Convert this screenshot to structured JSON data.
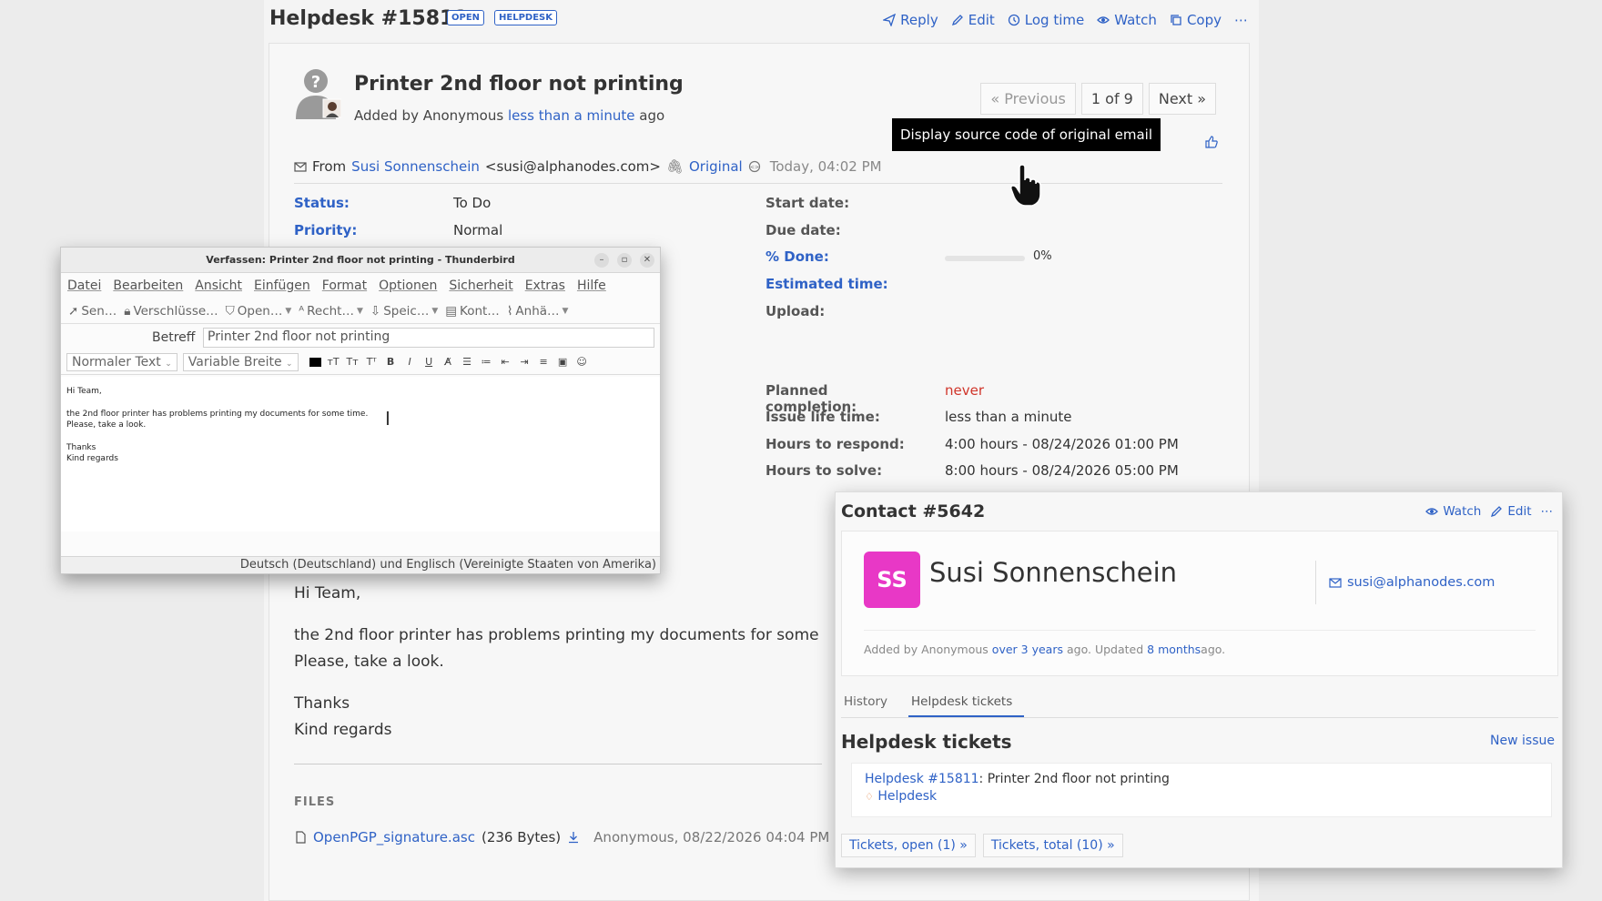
{
  "issue": {
    "title": "Helpdesk #15811",
    "badges": [
      "OPEN",
      "HELPDESK"
    ],
    "actions": [
      "Reply",
      "Edit",
      "Log time",
      "Watch",
      "Copy"
    ],
    "subject": "Printer 2nd floor not printing",
    "added_prefix": "Added by Anonymous",
    "added_time": "less than a minute",
    "added_suffix": "ago",
    "pager": {
      "previous": "« Previous",
      "position": "1 of 9",
      "next": "Next »"
    },
    "from_label": "From",
    "from_name": "Susi Sonnenschein",
    "from_email": "<susi@alphanodes.com>",
    "original_label": "Original",
    "from_date": "Today, 04:02 PM",
    "tooltip": "Display source code of original email",
    "attributes_left": [
      {
        "key": "Status:",
        "value": "To Do"
      },
      {
        "key": "Priority:",
        "value": "Normal"
      }
    ],
    "attributes_right": [
      {
        "key": "Start date:",
        "value": ""
      },
      {
        "key": "Due date:",
        "value": ""
      },
      {
        "key": "% Done:",
        "value": "0%"
      },
      {
        "key": "Estimated time:",
        "value": ""
      },
      {
        "key": "Upload:",
        "value": ""
      }
    ],
    "done_ratio": 0,
    "sla": [
      {
        "key": "Planned completion:",
        "value": "never"
      },
      {
        "key": "Issue life time:",
        "value": "less than a minute"
      },
      {
        "key": "Hours to respond:",
        "value": "4:00 hours - 08/24/2026 01:00 PM"
      },
      {
        "key": "Hours to solve:",
        "value": "8:00 hours - 08/24/2026 05:00 PM"
      }
    ],
    "description": {
      "greeting": "Hi Team,",
      "line1": "the 2nd floor printer has problems printing my documents for some",
      "line2": "Please, take a look.",
      "thanks": "Thanks",
      "regards": "Kind regards"
    },
    "files_title": "FILES",
    "file": {
      "name": "OpenPGP_signature.asc",
      "size": "(236 Bytes)",
      "meta": "Anonymous, 08/22/2026 04:04 PM"
    }
  },
  "thunderbird": {
    "title": "Verfassen: Printer 2nd floor not printing - Thunderbird",
    "menu": [
      "Datei",
      "Bearbeiten",
      "Ansicht",
      "Einfügen",
      "Format",
      "Optionen",
      "Sicherheit",
      "Extras",
      "Hilfe"
    ],
    "toolbar": [
      "Sen…",
      "Verschlüsse…",
      "Open…",
      "Recht…",
      "Speic…",
      "Kont…",
      "Anhä…"
    ],
    "subject_label": "Betreff",
    "subject_value": "Printer 2nd floor not printing",
    "paragraph_style": "Normaler Text",
    "font": "Variable Breite",
    "body": {
      "greeting": "Hi Team,",
      "line1": "the 2nd floor printer has problems printing my documents for some time.",
      "line2": "Please, take a look.",
      "thanks": "Thanks",
      "regards": "Kind regards"
    },
    "status_bar": "Deutsch (Deutschland) und Englisch (Vereinigte Staaten von Amerika)"
  },
  "contact": {
    "title": "Contact #5642",
    "actions": [
      "Watch",
      "Edit"
    ],
    "initials": "SS",
    "name": "Susi Sonnenschein",
    "email": "susi@alphanodes.com",
    "added_prefix": "Added by Anonymous",
    "added_time": "over 3 years",
    "updated_prefix": "ago. Updated",
    "updated_time": "8 months",
    "updated_suffix": "ago.",
    "tabs": [
      "History",
      "Helpdesk tickets"
    ],
    "section_title": "Helpdesk tickets",
    "new_issue": "New issue",
    "ticket_link": "Helpdesk #15811",
    "ticket_subject": ": Printer 2nd floor not printing",
    "ticket_tracker": "Helpdesk",
    "buttons": [
      "Tickets, open (1) »",
      "Tickets, total (10) »"
    ]
  },
  "colors": {
    "link": "#2f62c6",
    "avatar": "#e838c6",
    "never": "#d0352a"
  }
}
